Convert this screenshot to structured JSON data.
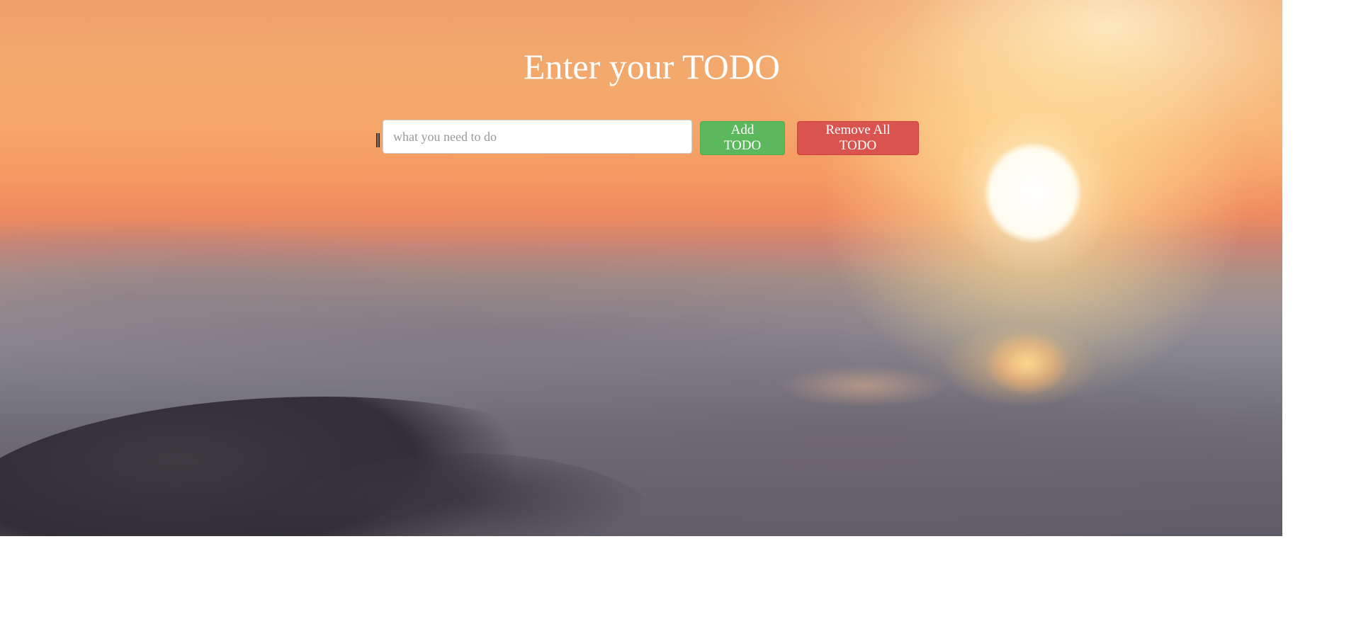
{
  "page": {
    "title": "Enter your TODO"
  },
  "form": {
    "input_placeholder": "what you need to do",
    "input_value": "",
    "add_label": "Add TODO",
    "remove_all_label": "Remove All TODO"
  },
  "colors": {
    "add_button": "#5cb85c",
    "remove_button": "#d9534f",
    "title_text": "#ffffff"
  }
}
